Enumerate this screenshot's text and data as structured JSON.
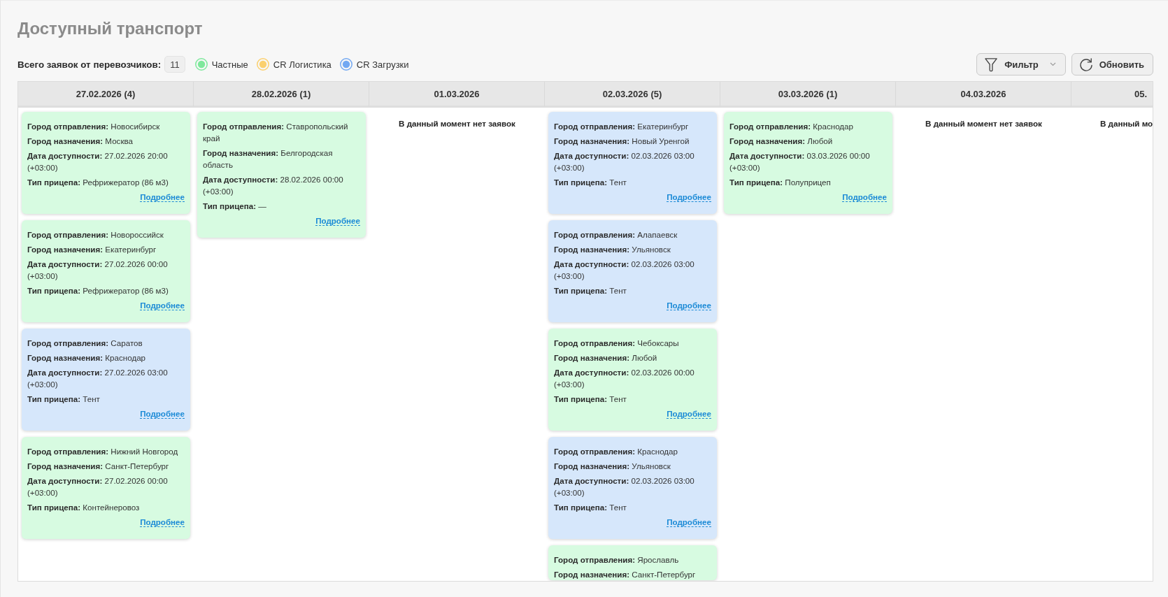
{
  "page": {
    "title": "Доступный транспорт"
  },
  "summary": {
    "label": "Всего заявок от перевозчиков:",
    "count": "11"
  },
  "legend": [
    {
      "label": "Частные",
      "color": "#7ee89c"
    },
    {
      "label": "CR Логистика",
      "color": "#fbd06e"
    },
    {
      "label": "CR Загрузки",
      "color": "#72a8f2"
    }
  ],
  "buttons": [
    {
      "kind": "filter",
      "label": "Фильтр"
    },
    {
      "kind": "refresh",
      "label": "Обновить"
    }
  ],
  "board": {
    "columns": [
      {
        "date": "27.02.2026 (4)",
        "cut_off": false,
        "cards": [
          {
            "color": "#d7fbe1",
            "fields": [
              "**Город отправления:** Новосибирск",
              "**Город назначения:** Москва",
              "**Дата доступности:** 27.02.2026 20:00 (+03:00)",
              "**Тип прицепа:** Рефрижератор (86 м3)"
            ],
            "link": "Подробнее"
          },
          {
            "color": "#d7fbe1",
            "fields": [
              "**Город отправления:** Новороссийск",
              "**Город назначения:** Екатеринбург",
              "**Дата доступности:** 27.02.2026 00:00 (+03:00)",
              "**Тип прицепа:** Рефрижератор (86 м3)"
            ],
            "link": "Подробнее"
          },
          {
            "color": "#d6e7fb",
            "fields": [
              "**Город отправления:** Саратов",
              "**Город назначения:** Краснодар",
              "**Дата доступности:** 27.02.2026 03:00 (+03:00)",
              "**Тип прицепа:** Тент"
            ],
            "link": "Подробнее"
          },
          {
            "color": "#d7fbe1",
            "fields": [
              "**Город отправления:** Нижний Новгород",
              "**Город назначения:** Санкт-Петербург",
              "**Дата доступности:** 27.02.2026 00:00 (+03:00)",
              "**Тип прицепа:** Контейнеровоз"
            ],
            "link": "Подробнее"
          }
        ]
      },
      {
        "date": "28.02.2026 (1)",
        "cut_off": false,
        "cards": [
          {
            "color": "#d7fbe1",
            "fields": [
              "**Город отправления:** Ставропольский край",
              "**Город назначения:** Белгородская область",
              "**Дата доступности:** 28.02.2026 00:00 (+03:00)",
              "**Тип прицепа:** —"
            ],
            "link": "Подробнее"
          }
        ]
      },
      {
        "date": "01.03.2026",
        "cut_off": false,
        "empty_text": "В данный момент нет заявок"
      },
      {
        "date": "02.03.2026 (5)",
        "cut_off": false,
        "cards": [
          {
            "color": "#d6e7fb",
            "fields": [
              "**Город отправления:** Екатеринбург",
              "**Город назначения:** Новый Уренгой",
              "**Дата доступности:** 02.03.2026 03:00 (+03:00)",
              "**Тип прицепа:** Тент"
            ],
            "link": "Подробнее"
          },
          {
            "color": "#d6e7fb",
            "fields": [
              "**Город отправления:** Алапаевск",
              "**Город назначения:** Ульяновск",
              "**Дата доступности:** 02.03.2026 03:00 (+03:00)",
              "**Тип прицепа:** Тент"
            ],
            "link": "Подробнее"
          },
          {
            "color": "#d7fbe1",
            "fields": [
              "**Город отправления:** Чебоксары",
              "**Город назначения:** Любой",
              "**Дата доступности:** 02.03.2026 00:00 (+03:00)",
              "**Тип прицепа:** Тент"
            ],
            "link": "Подробнее"
          },
          {
            "color": "#d6e7fb",
            "fields": [
              "**Город отправления:** Краснодар",
              "**Город назначения:** Ульяновск",
              "**Дата доступности:** 02.03.2026 03:00 (+03:00)",
              "**Тип прицепа:** Тент"
            ],
            "link": "Подробнее"
          },
          {
            "color": "#d7fbe1",
            "fields": [
              "**Город отправления:** Ярославль",
              "**Город назначения:** Санкт-Петербург"
            ]
          }
        ]
      },
      {
        "date": "03.03.2026 (1)",
        "cut_off": false,
        "cards": [
          {
            "color": "#d7fbe1",
            "fields": [
              "**Город отправления:** Краснодар",
              "**Город назначения:** Любой",
              "**Дата доступности:** 03.03.2026 00:00 (+03:00)",
              "**Тип прицепа:** Полуприцеп"
            ],
            "link": "Подробнее"
          }
        ]
      },
      {
        "date": "04.03.2026",
        "cut_off": false,
        "empty_text": "В данный момент нет заявок"
      },
      {
        "date": "05.",
        "cut_off": true,
        "empty_text": "В данный мо"
      }
    ]
  }
}
